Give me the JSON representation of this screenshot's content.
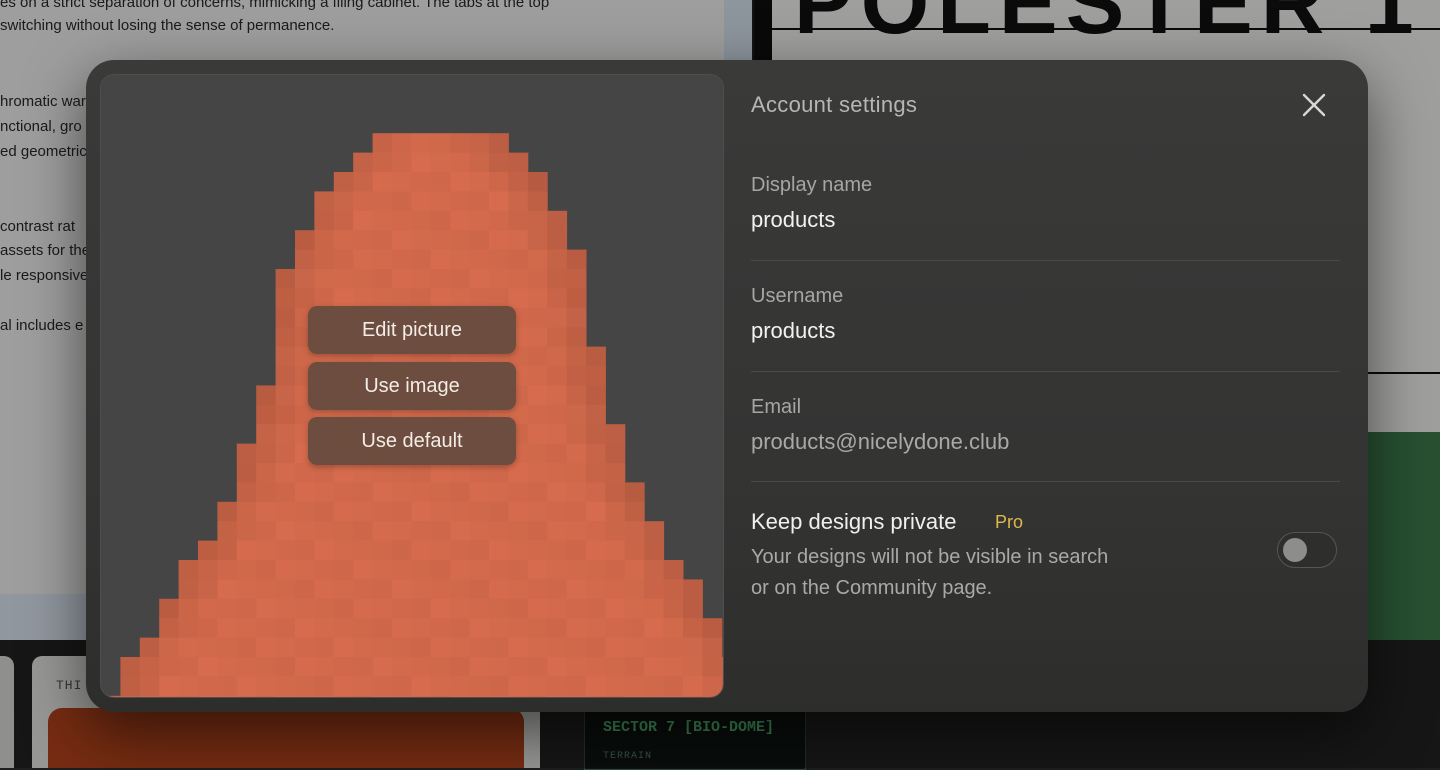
{
  "background": {
    "doc_lines": [
      "es on a strict separation of concerns, mimicking a filing cabinet. The tabs at the top",
      "switching without losing the sense of permanence.",
      "hromatic war",
      "nctional, gro",
      "ed geometric",
      " contrast rat",
      "assets for the",
      "le responsive",
      "al includes e"
    ],
    "poster_text": "POLESTER 1",
    "card_tag": "THI",
    "sector_label": "SECTOR 7 [BIO-DOME]",
    "terrain_label": "TERRAIN"
  },
  "modal": {
    "title": "Account settings",
    "close_icon": "close-icon",
    "picture_menu": {
      "edit_label": "Edit picture",
      "use_image_label": "Use image",
      "use_default_label": "Use default"
    },
    "fields": [
      {
        "label": "Display name",
        "value": "products"
      },
      {
        "label": "Username",
        "value": "products"
      },
      {
        "label": "Email",
        "value": "products@nicelydone.club"
      }
    ],
    "privacy": {
      "label": "Keep designs private",
      "badge": "Pro",
      "description": "Your designs will not be visible in search or on the Community page.",
      "enabled": false
    }
  },
  "colors": {
    "avatar": "#d2694a",
    "pro_badge": "#e0b84c",
    "menu_button": "#644b3e"
  }
}
